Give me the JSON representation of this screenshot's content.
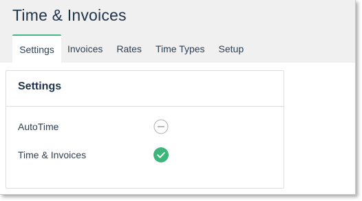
{
  "app": {
    "title": "Time & Invoices"
  },
  "tabs": [
    {
      "label": "Settings",
      "active": true
    },
    {
      "label": "Invoices",
      "active": false
    },
    {
      "label": "Rates",
      "active": false
    },
    {
      "label": "Time Types",
      "active": false
    },
    {
      "label": "Setup",
      "active": false
    }
  ],
  "settings_panel": {
    "title": "Settings",
    "rows": [
      {
        "label": "AutoTime",
        "status": "disabled",
        "icon": "minus-circle-icon"
      },
      {
        "label": "Time & Invoices",
        "status": "enabled",
        "icon": "check-circle-icon"
      }
    ]
  },
  "colors": {
    "accent": "#46b982",
    "title_text": "#1e3348",
    "header_bg": "#f0f0f1",
    "enabled": "#3db57b",
    "disabled_outline": "#b9bcc0"
  }
}
